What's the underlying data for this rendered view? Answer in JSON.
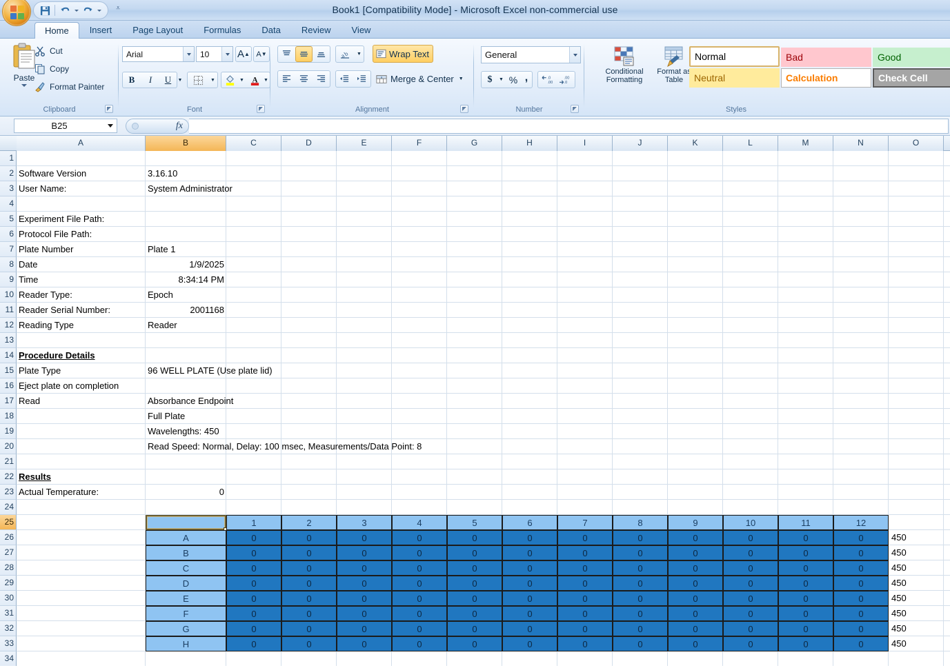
{
  "window": {
    "title": "Book1  [Compatibility Mode] - Microsoft Excel non-commercial use",
    "orb_name": "office-button"
  },
  "quick_access": {
    "save": "Save",
    "undo": "Undo",
    "redo": "Redo",
    "customize": "Customize Quick Access Toolbar"
  },
  "tabs": [
    {
      "label": "Home",
      "active": true
    },
    {
      "label": "Insert",
      "active": false
    },
    {
      "label": "Page Layout",
      "active": false
    },
    {
      "label": "Formulas",
      "active": false
    },
    {
      "label": "Data",
      "active": false
    },
    {
      "label": "Review",
      "active": false
    },
    {
      "label": "View",
      "active": false
    }
  ],
  "ribbon": {
    "clipboard": {
      "label": "Clipboard",
      "paste": "Paste",
      "cut": "Cut",
      "copy": "Copy",
      "format_painter": "Format Painter"
    },
    "font": {
      "label": "Font",
      "font_family": "Arial",
      "font_size": "10",
      "grow_font": "A",
      "shrink_font": "A",
      "bold": "B",
      "italic": "I",
      "underline": "U"
    },
    "alignment": {
      "label": "Alignment",
      "wrap_text": "Wrap Text",
      "merge_center": "Merge & Center"
    },
    "number": {
      "label": "Number",
      "format": "General",
      "currency": "$",
      "percent": "%",
      "comma": ","
    },
    "styles": {
      "label": "Styles",
      "conditional_formatting": "Conditional\nFormatting",
      "conditional_formatting_l1": "Conditional",
      "conditional_formatting_l2": "Formatting",
      "format_as_table_l1": "Format as",
      "format_as_table_l2": "Table",
      "cells": [
        {
          "label": "Normal",
          "bg": "#ffffff",
          "fg": "#000000",
          "border": "#d8b36a"
        },
        {
          "label": "Bad",
          "bg": "#ffc7ce",
          "fg": "#9c0006",
          "border": "#ffc7ce"
        },
        {
          "label": "Good",
          "bg": "#c6efce",
          "fg": "#006100",
          "border": "#c6efce"
        },
        {
          "label": "Neutral",
          "bg": "#ffeb9c",
          "fg": "#9c6500",
          "border": "#ffeb9c"
        },
        {
          "label": "Calculation",
          "bg": "#ffffff",
          "fg": "#fa7d00",
          "border": "#b2b2b2"
        },
        {
          "label": "Check Cell",
          "bg": "#a5a5a5",
          "fg": "#ffffff",
          "border": "#5c5c5c"
        }
      ]
    }
  },
  "formula_bar": {
    "name_box": "B25",
    "formula": ""
  },
  "grid": {
    "columns": [
      "A",
      "B",
      "C",
      "D",
      "E",
      "F",
      "G",
      "H",
      "I",
      "J",
      "K",
      "L",
      "M",
      "N",
      "O"
    ],
    "selected_column": "B",
    "selected_row": 25,
    "rows": [
      1,
      2,
      3,
      4,
      5,
      6,
      7,
      8,
      9,
      10,
      11,
      12,
      13,
      14,
      15,
      16,
      17,
      18,
      19,
      20,
      21,
      22,
      23,
      24,
      25,
      26,
      27,
      28,
      29,
      30,
      31,
      32,
      33,
      34
    ],
    "cells": [
      {
        "row": 2,
        "col": "A",
        "value": "Software Version",
        "align": "left"
      },
      {
        "row": 2,
        "col": "B",
        "value": "3.16.10",
        "align": "left"
      },
      {
        "row": 3,
        "col": "A",
        "value": "User Name:",
        "align": "left"
      },
      {
        "row": 3,
        "col": "B",
        "value": "System Administrator",
        "align": "left"
      },
      {
        "row": 5,
        "col": "A",
        "value": "Experiment File Path:",
        "align": "left"
      },
      {
        "row": 6,
        "col": "A",
        "value": "Protocol File Path:",
        "align": "left"
      },
      {
        "row": 7,
        "col": "A",
        "value": "Plate Number",
        "align": "left"
      },
      {
        "row": 7,
        "col": "B",
        "value": "Plate 1",
        "align": "left"
      },
      {
        "row": 8,
        "col": "A",
        "value": "Date",
        "align": "left"
      },
      {
        "row": 8,
        "col": "B",
        "value": "1/9/2025",
        "align": "right"
      },
      {
        "row": 9,
        "col": "A",
        "value": "Time",
        "align": "left"
      },
      {
        "row": 9,
        "col": "B",
        "value": "8:34:14 PM",
        "align": "right"
      },
      {
        "row": 10,
        "col": "A",
        "value": "Reader Type:",
        "align": "left"
      },
      {
        "row": 10,
        "col": "B",
        "value": "Epoch",
        "align": "left"
      },
      {
        "row": 11,
        "col": "A",
        "value": "Reader Serial Number:",
        "align": "left"
      },
      {
        "row": 11,
        "col": "B",
        "value": "2001168",
        "align": "right"
      },
      {
        "row": 12,
        "col": "A",
        "value": "Reading Type",
        "align": "left"
      },
      {
        "row": 12,
        "col": "B",
        "value": "Reader",
        "align": "left"
      },
      {
        "row": 14,
        "col": "A",
        "value": "Procedure Details",
        "align": "left",
        "style": "bold-underline"
      },
      {
        "row": 15,
        "col": "A",
        "value": "Plate Type",
        "align": "left"
      },
      {
        "row": 15,
        "col": "B",
        "value": "96 WELL PLATE (Use plate lid)",
        "align": "left"
      },
      {
        "row": 16,
        "col": "A",
        "value": "Eject plate on completion",
        "align": "left"
      },
      {
        "row": 17,
        "col": "A",
        "value": "Read",
        "align": "left"
      },
      {
        "row": 17,
        "col": "B",
        "value": "Absorbance Endpoint",
        "align": "left"
      },
      {
        "row": 18,
        "col": "B",
        "value": "Full Plate",
        "align": "left"
      },
      {
        "row": 19,
        "col": "B",
        "value": "Wavelengths:  450",
        "align": "left"
      },
      {
        "row": 20,
        "col": "B",
        "value": "Read Speed: Normal,  Delay: 100 msec,  Measurements/Data Point: 8",
        "align": "left"
      },
      {
        "row": 22,
        "col": "A",
        "value": "Results",
        "align": "left",
        "style": "bold-underline"
      },
      {
        "row": 23,
        "col": "A",
        "value": "Actual Temperature:",
        "align": "left"
      },
      {
        "row": 23,
        "col": "B",
        "value": "0",
        "align": "right"
      }
    ]
  },
  "plate": {
    "corner_cell": "",
    "column_headers": [
      "1",
      "2",
      "3",
      "4",
      "5",
      "6",
      "7",
      "8",
      "9",
      "10",
      "11",
      "12"
    ],
    "row_labels": [
      "A",
      "B",
      "C",
      "D",
      "E",
      "F",
      "G",
      "H"
    ],
    "values": [
      [
        "0",
        "0",
        "0",
        "0",
        "0",
        "0",
        "0",
        "0",
        "0",
        "0",
        "0",
        "0"
      ],
      [
        "0",
        "0",
        "0",
        "0",
        "0",
        "0",
        "0",
        "0",
        "0",
        "0",
        "0",
        "0"
      ],
      [
        "0",
        "0",
        "0",
        "0",
        "0",
        "0",
        "0",
        "0",
        "0",
        "0",
        "0",
        "0"
      ],
      [
        "0",
        "0",
        "0",
        "0",
        "0",
        "0",
        "0",
        "0",
        "0",
        "0",
        "0",
        "0"
      ],
      [
        "0",
        "0",
        "0",
        "0",
        "0",
        "0",
        "0",
        "0",
        "0",
        "0",
        "0",
        "0"
      ],
      [
        "0",
        "0",
        "0",
        "0",
        "0",
        "0",
        "0",
        "0",
        "0",
        "0",
        "0",
        "0"
      ],
      [
        "0",
        "0",
        "0",
        "0",
        "0",
        "0",
        "0",
        "0",
        "0",
        "0",
        "0",
        "0"
      ],
      [
        "0",
        "0",
        "0",
        "0",
        "0",
        "0",
        "0",
        "0",
        "0",
        "0",
        "0",
        "0"
      ]
    ],
    "wavelength_labels": [
      "450",
      "450",
      "450",
      "450",
      "450",
      "450",
      "450",
      "450"
    ],
    "header_bg": "#8fc4f2",
    "cell_bg": "#2077c0",
    "border_color": "#1b1b1b"
  }
}
